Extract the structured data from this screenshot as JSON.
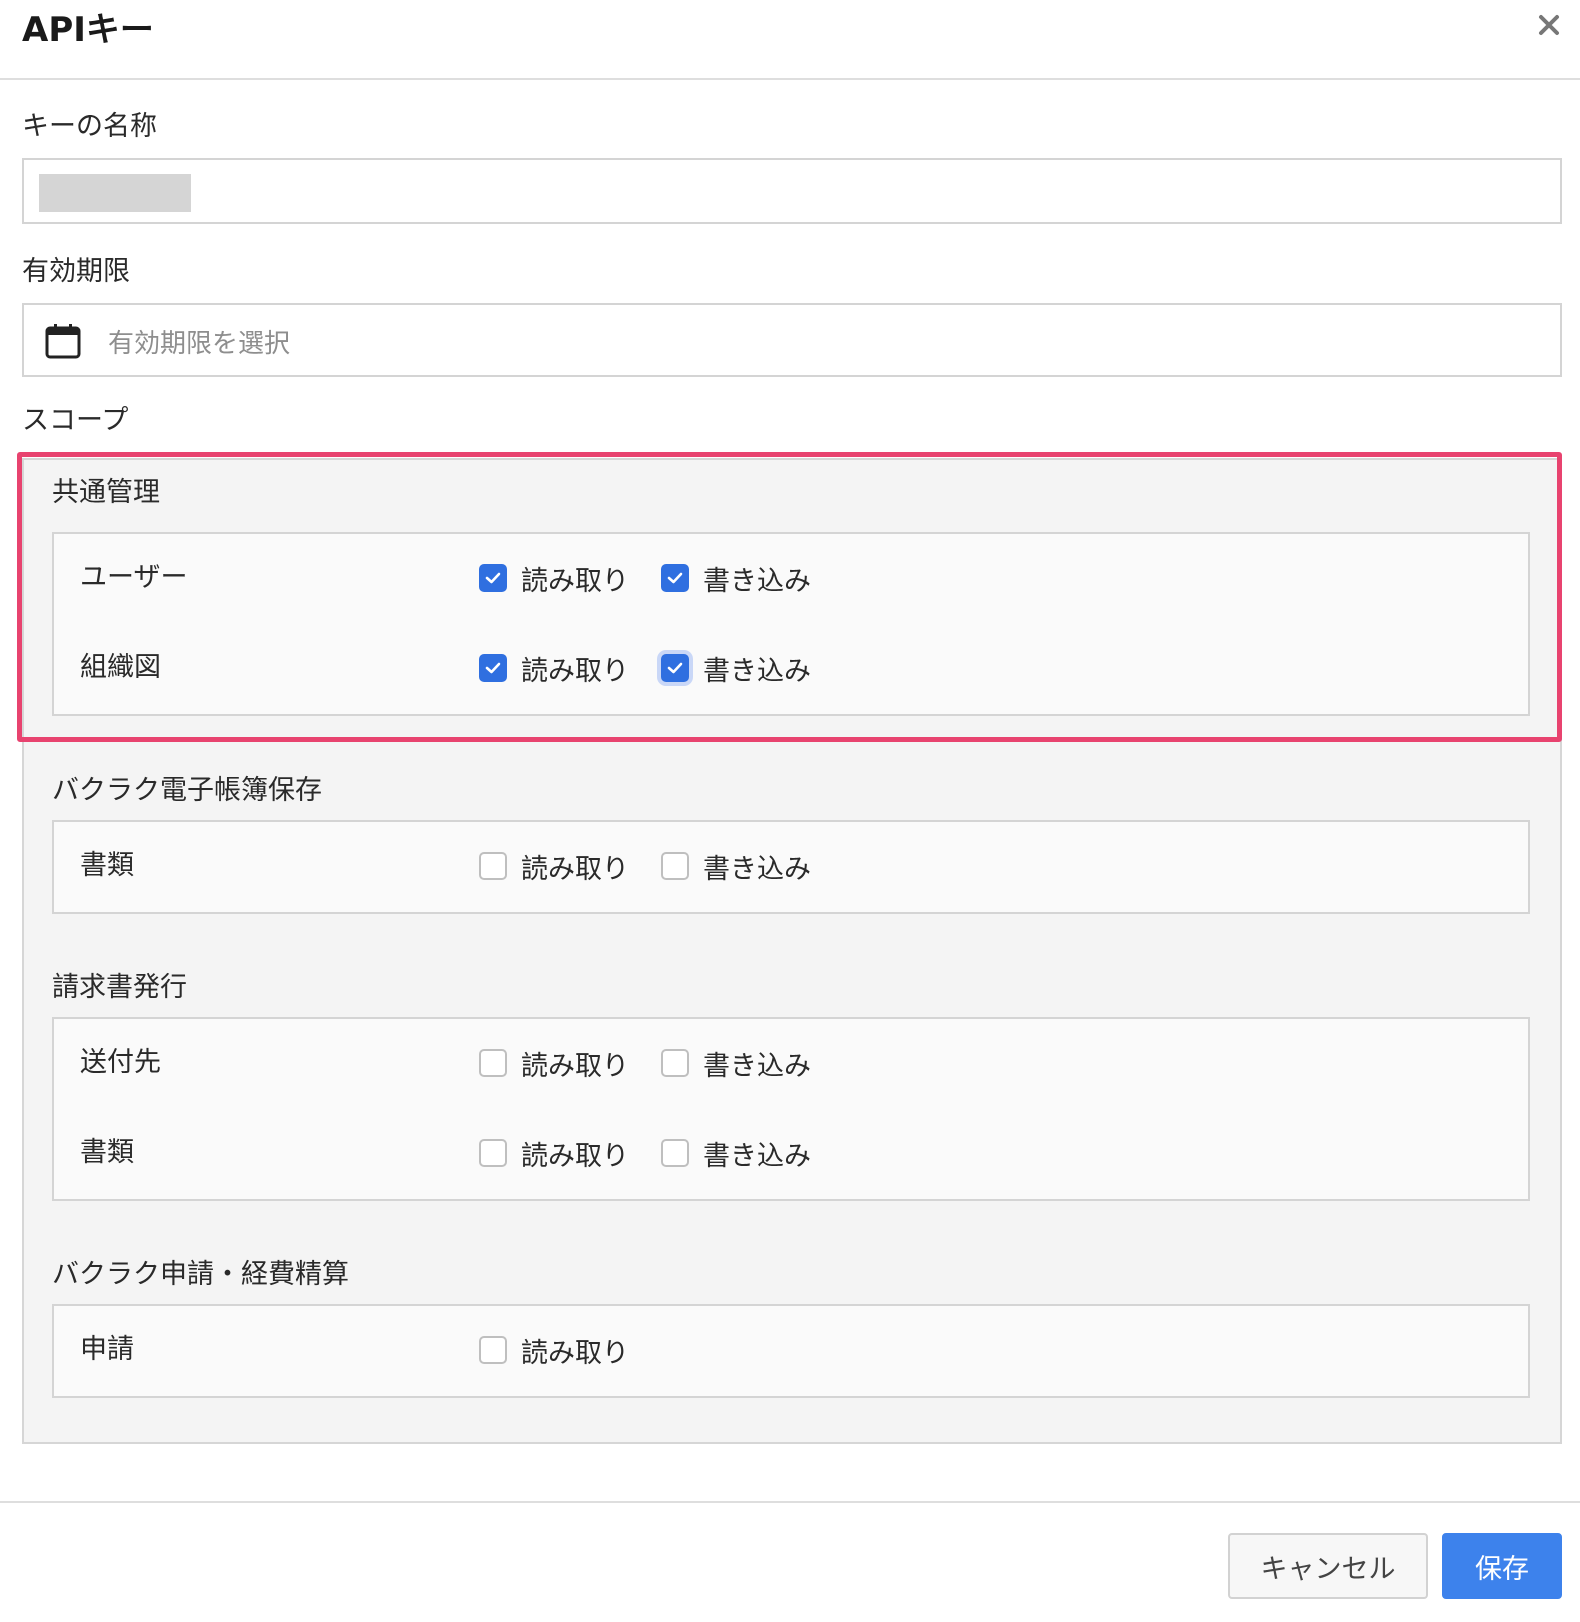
{
  "dialog": {
    "title": "APIキー",
    "close_icon": "close-icon"
  },
  "form": {
    "name_label": "キーの名称",
    "expiry_label": "有効期限",
    "expiry_placeholder": "有効期限を選択",
    "calendar_icon": "calendar-icon",
    "scope_label": "スコープ"
  },
  "scopes": {
    "groups": [
      {
        "title": "共通管理",
        "rows": [
          {
            "label": "ユーザー",
            "read": {
              "label": "読み取り",
              "checked": true
            },
            "write": {
              "label": "書き込み",
              "checked": true
            }
          },
          {
            "label": "組織図",
            "read": {
              "label": "読み取り",
              "checked": true
            },
            "write": {
              "label": "書き込み",
              "checked": true,
              "focused": true
            }
          }
        ]
      },
      {
        "title": "バクラク電子帳簿保存",
        "rows": [
          {
            "label": "書類",
            "read": {
              "label": "読み取り",
              "checked": false
            },
            "write": {
              "label": "書き込み",
              "checked": false
            }
          }
        ]
      },
      {
        "title": "請求書発行",
        "rows": [
          {
            "label": "送付先",
            "read": {
              "label": "読み取り",
              "checked": false
            },
            "write": {
              "label": "書き込み",
              "checked": false
            }
          },
          {
            "label": "書類",
            "read": {
              "label": "読み取り",
              "checked": false
            },
            "write": {
              "label": "書き込み",
              "checked": false
            }
          }
        ]
      },
      {
        "title": "バクラク申請・経費精算",
        "rows": [
          {
            "label": "申請",
            "read": {
              "label": "読み取り",
              "checked": false
            }
          }
        ]
      }
    ]
  },
  "footer": {
    "cancel_label": "キャンセル",
    "save_label": "保存"
  },
  "colors": {
    "accent": "#3d82ec",
    "checkbox_checked": "#2f6fe0",
    "highlight": "#e8436f"
  }
}
